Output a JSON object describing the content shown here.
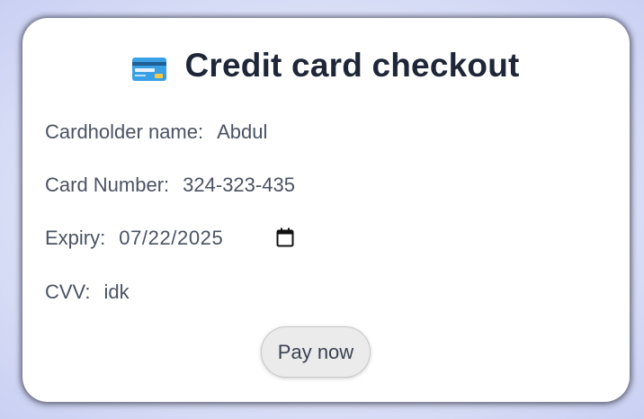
{
  "form": {
    "title": "Credit card checkout",
    "title_icon": "credit-card-icon",
    "fields": {
      "cardholder": {
        "label": "Cardholder name:",
        "value": "Abdul"
      },
      "card_number": {
        "label": "Card Number:",
        "value": "324-323-435"
      },
      "expiry": {
        "label": "Expiry:",
        "value": "07/22/2025",
        "icon": "calendar-icon"
      },
      "cvv": {
        "label": "CVV:",
        "value": "idk"
      }
    },
    "submit_label": "Pay now"
  },
  "colors": {
    "background": "#dfe3f8",
    "card": "#ffffff",
    "title_text": "#1e2637",
    "body_text": "#4b5262",
    "button_bg": "#ebebeb"
  }
}
